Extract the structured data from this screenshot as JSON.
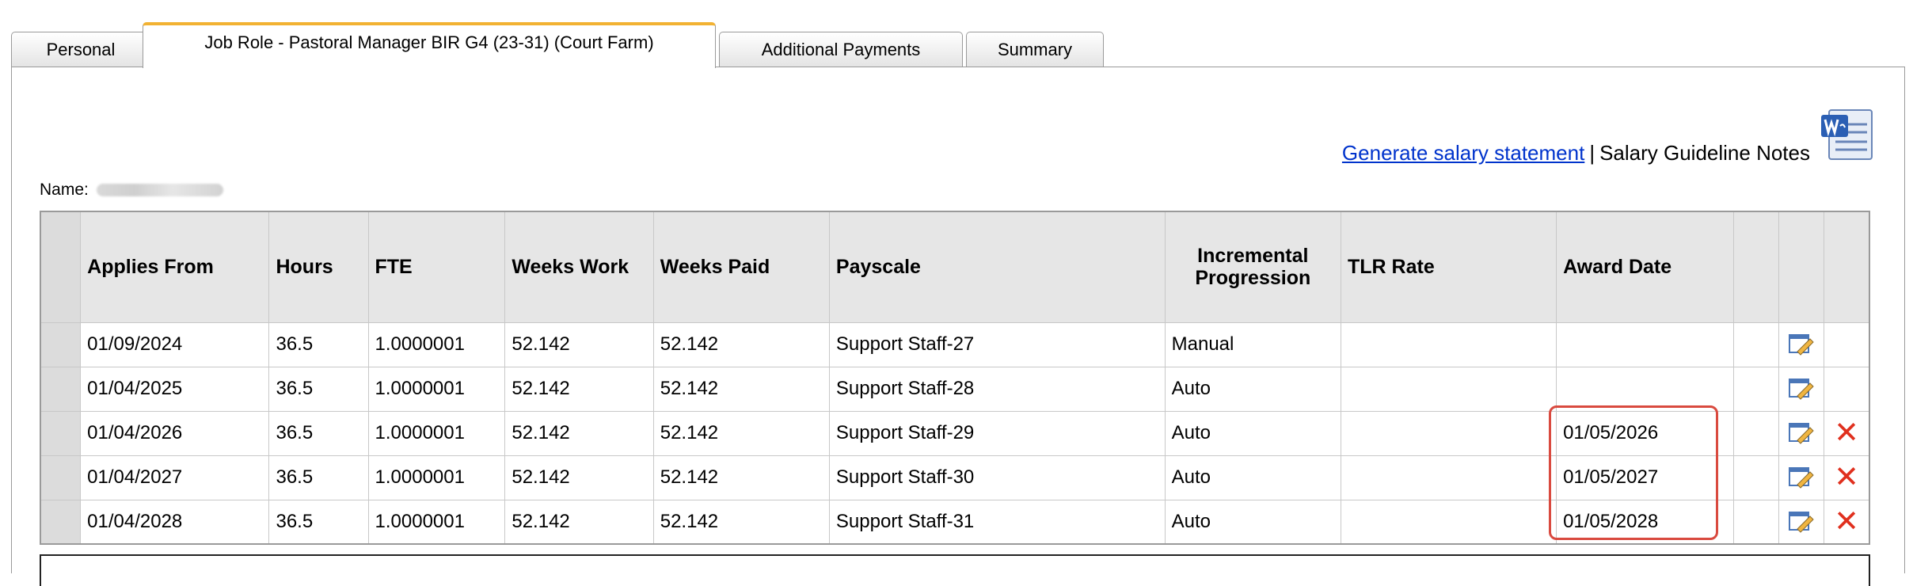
{
  "tabs": [
    {
      "label": "Personal"
    },
    {
      "label": "Job Role - Pastoral Manager BIR G4 (23-31) (Court Farm)"
    },
    {
      "label": "Additional Payments"
    },
    {
      "label": "Summary"
    }
  ],
  "links": {
    "generate": "Generate salary statement",
    "separator": "|",
    "guideline": "Salary Guideline Notes"
  },
  "name_label": "Name:",
  "columns": {
    "applies_from": "Applies From",
    "hours": "Hours",
    "fte": "FTE",
    "weeks_work": "Weeks Work",
    "weeks_paid": "Weeks Paid",
    "payscale": "Payscale",
    "incremental_1": "Incremental",
    "incremental_2": "Progression",
    "tlr_rate": "TLR Rate",
    "award_date": "Award Date"
  },
  "rows": [
    {
      "applies_from": "01/09/2024",
      "hours": "36.5",
      "fte": "1.0000001",
      "weeks_work": "52.142",
      "weeks_paid": "52.142",
      "payscale": "Support Staff-27",
      "incremental": "Manual",
      "tlr_rate": "",
      "award_date": ""
    },
    {
      "applies_from": "01/04/2025",
      "hours": "36.5",
      "fte": "1.0000001",
      "weeks_work": "52.142",
      "weeks_paid": "52.142",
      "payscale": "Support Staff-28",
      "incremental": "Auto",
      "tlr_rate": "",
      "award_date": ""
    },
    {
      "applies_from": "01/04/2026",
      "hours": "36.5",
      "fte": "1.0000001",
      "weeks_work": "52.142",
      "weeks_paid": "52.142",
      "payscale": "Support Staff-29",
      "incremental": "Auto",
      "tlr_rate": "",
      "award_date": "01/05/2026"
    },
    {
      "applies_from": "01/04/2027",
      "hours": "36.5",
      "fte": "1.0000001",
      "weeks_work": "52.142",
      "weeks_paid": "52.142",
      "payscale": "Support Staff-30",
      "incremental": "Auto",
      "tlr_rate": "",
      "award_date": "01/05/2027"
    },
    {
      "applies_from": "01/04/2028",
      "hours": "36.5",
      "fte": "1.0000001",
      "weeks_work": "52.142",
      "weeks_paid": "52.142",
      "payscale": "Support Staff-31",
      "incremental": "Auto",
      "tlr_rate": "",
      "award_date": "01/05/2028"
    }
  ],
  "icons": {
    "edit": "edit-icon",
    "delete": "delete-icon",
    "word": "word-document-icon"
  },
  "colors": {
    "active_tab_accent": "#f2b233",
    "link": "#0033cc",
    "delete": "#e0301e",
    "highlight": "#d94a3f"
  }
}
